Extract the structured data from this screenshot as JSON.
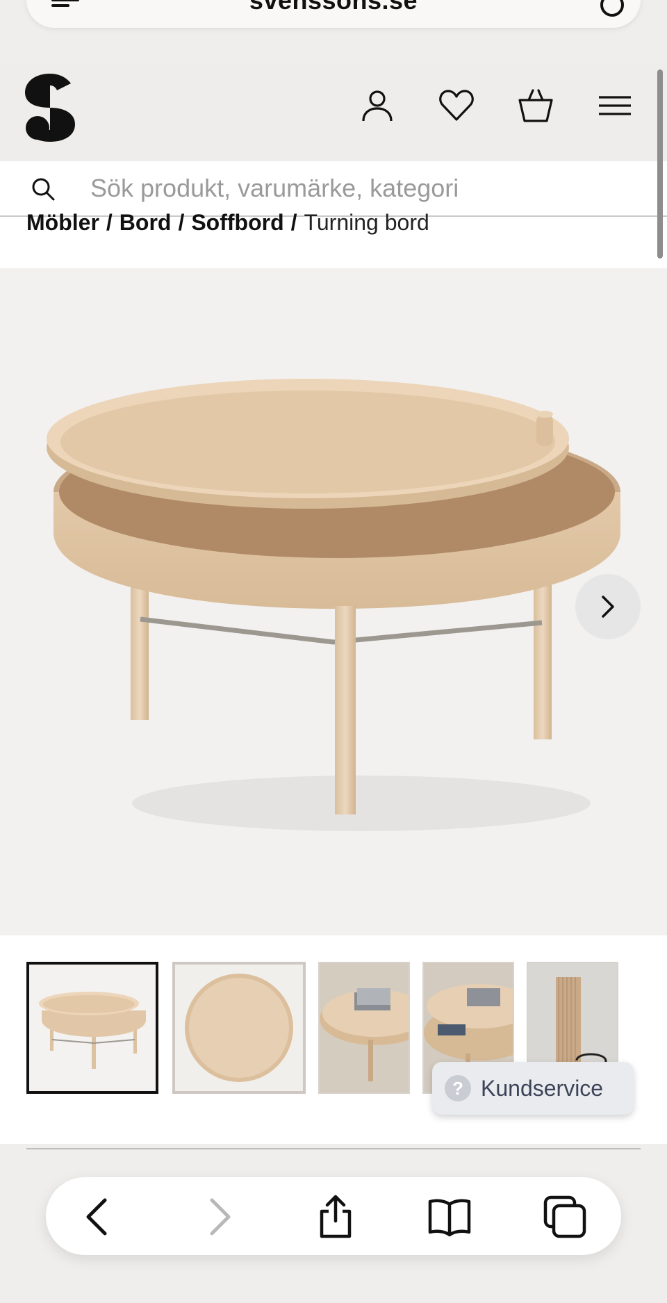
{
  "browser": {
    "domain": "svenssons.se",
    "toolbar": {
      "back": "back-icon",
      "forward": "forward-icon",
      "share": "share-icon",
      "bookmarks": "book-icon",
      "tabs": "tabs-icon"
    }
  },
  "header": {
    "icons": [
      "user-icon",
      "heart-icon",
      "basket-icon",
      "menu-icon"
    ]
  },
  "search": {
    "placeholder": "Sök produkt, varumärke, kategori"
  },
  "breadcrumb": {
    "items": [
      "Möbler",
      "Bord",
      "Soffbord"
    ],
    "separator": "/",
    "current": "Turning bord"
  },
  "gallery": {
    "thumbnail_count": 5,
    "selected_index": 0
  },
  "support": {
    "label": "Kundservice",
    "icon": "?"
  },
  "colors": {
    "wood": "#e6cfb3",
    "wood_dark": "#d3b894",
    "accent_text": "#3c4458"
  }
}
